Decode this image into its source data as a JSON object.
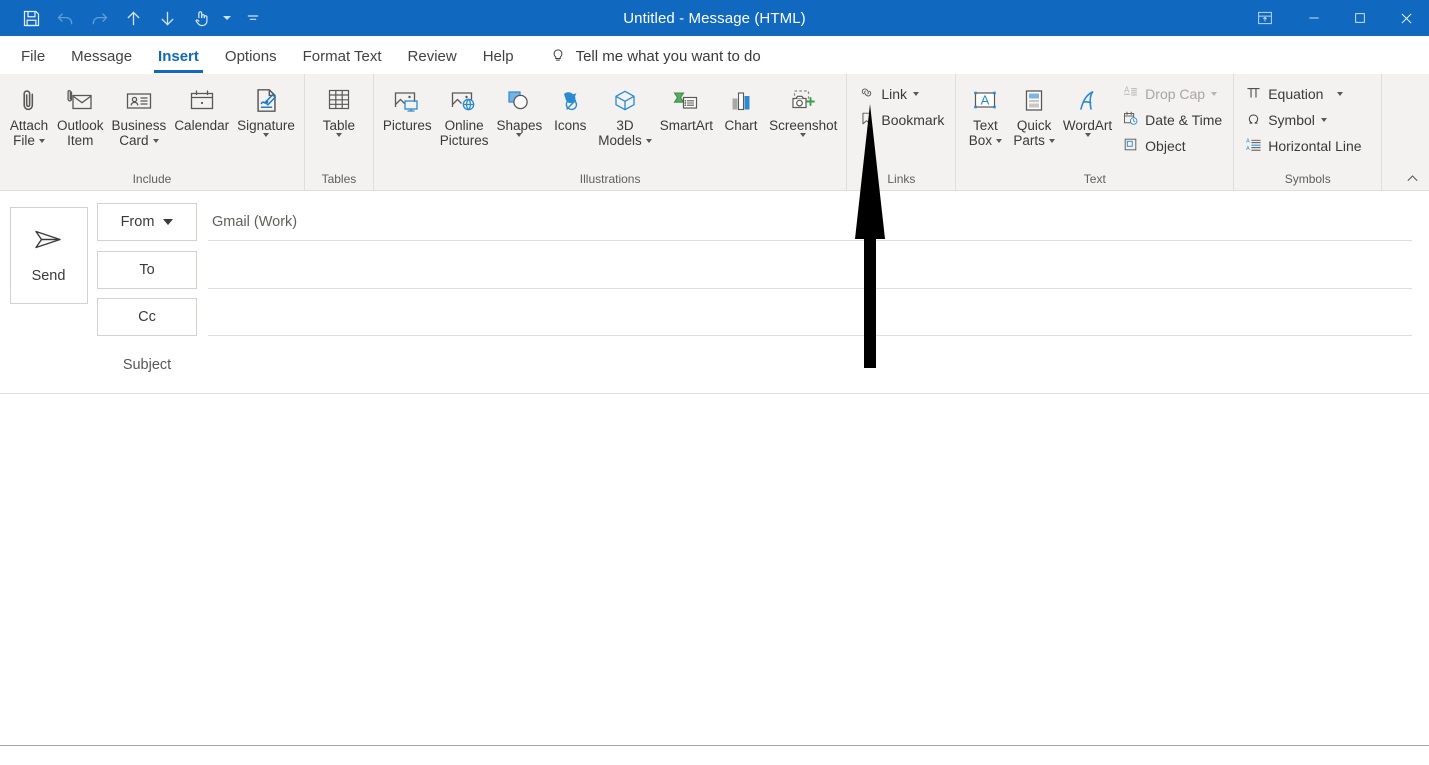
{
  "window": {
    "title": "Untitled  -  Message (HTML)",
    "quick_access": [
      {
        "name": "save-icon",
        "label": "Save"
      },
      {
        "name": "undo-icon",
        "label": "Undo"
      },
      {
        "name": "redo-icon",
        "label": "Redo"
      },
      {
        "name": "previous-item-icon",
        "label": "Previous Item"
      },
      {
        "name": "next-item-icon",
        "label": "Next Item"
      },
      {
        "name": "touch-mode-icon",
        "label": "Touch/Mouse Mode"
      }
    ],
    "controls": [
      {
        "name": "ribbon-display-options-button",
        "label": "Ribbon Display Options"
      },
      {
        "name": "minimize-button",
        "label": "Minimize"
      },
      {
        "name": "maximize-button",
        "label": "Maximize"
      },
      {
        "name": "close-button",
        "label": "Close"
      }
    ]
  },
  "tabs": [
    {
      "label": "File",
      "active": false
    },
    {
      "label": "Message",
      "active": false
    },
    {
      "label": "Insert",
      "active": true
    },
    {
      "label": "Options",
      "active": false
    },
    {
      "label": "Format Text",
      "active": false
    },
    {
      "label": "Review",
      "active": false
    },
    {
      "label": "Help",
      "active": false
    }
  ],
  "tell_me": {
    "icon": "lightbulb-icon",
    "placeholder": "Tell me what you want to do"
  },
  "ribbon": {
    "groups": [
      {
        "label": "Include",
        "buttons": [
          {
            "label_line1": "Attach",
            "label_line2": "File",
            "caret": true,
            "icon": "paperclip-icon"
          },
          {
            "label_line1": "Outlook",
            "label_line2": "Item",
            "caret": false,
            "icon": "envelope-attach-icon"
          },
          {
            "label_line1": "Business",
            "label_line2": "Card",
            "caret": true,
            "icon": "business-card-icon"
          },
          {
            "label_line1": "Calendar",
            "label_line2": "",
            "caret": false,
            "icon": "calendar-icon"
          },
          {
            "label_line1": "Signature",
            "label_line2": "",
            "caret": true,
            "icon": "signature-icon"
          }
        ]
      },
      {
        "label": "Tables",
        "buttons": [
          {
            "label_line1": "Table",
            "label_line2": "",
            "caret": true,
            "icon": "table-icon"
          }
        ]
      },
      {
        "label": "Illustrations",
        "buttons": [
          {
            "label_line1": "Pictures",
            "label_line2": "",
            "caret": false,
            "icon": "pictures-icon"
          },
          {
            "label_line1": "Online",
            "label_line2": "Pictures",
            "caret": false,
            "icon": "online-pictures-icon"
          },
          {
            "label_line1": "Shapes",
            "label_line2": "",
            "caret": true,
            "icon": "shapes-icon"
          },
          {
            "label_line1": "Icons",
            "label_line2": "",
            "caret": false,
            "icon": "icons-icon"
          },
          {
            "label_line1": "3D",
            "label_line2": "Models",
            "caret": true,
            "icon": "3d-models-icon"
          },
          {
            "label_line1": "SmartArt",
            "label_line2": "",
            "caret": false,
            "icon": "smartart-icon"
          },
          {
            "label_line1": "Chart",
            "label_line2": "",
            "caret": false,
            "icon": "chart-icon"
          },
          {
            "label_line1": "Screenshot",
            "label_line2": "",
            "caret": true,
            "icon": "screenshot-icon"
          }
        ]
      },
      {
        "label": "Links",
        "small_buttons": [
          {
            "label": "Link",
            "caret": true,
            "icon": "link-icon",
            "disabled": false
          },
          {
            "label": "Bookmark",
            "caret": false,
            "icon": "bookmark-icon",
            "disabled": false
          }
        ]
      },
      {
        "label": "Text",
        "buttons": [
          {
            "label_line1": "Text",
            "label_line2": "Box",
            "caret": true,
            "icon": "text-box-icon"
          },
          {
            "label_line1": "Quick",
            "label_line2": "Parts",
            "caret": true,
            "icon": "quick-parts-icon"
          },
          {
            "label_line1": "WordArt",
            "label_line2": "",
            "caret": true,
            "icon": "wordart-icon"
          }
        ],
        "small_buttons": [
          {
            "label": "Drop Cap",
            "caret": true,
            "icon": "drop-cap-icon",
            "disabled": true
          },
          {
            "label": "Date & Time",
            "caret": false,
            "icon": "date-time-icon",
            "disabled": false
          },
          {
            "label": "Object",
            "caret": false,
            "icon": "object-icon",
            "disabled": false
          }
        ]
      },
      {
        "label": "Symbols",
        "small_buttons": [
          {
            "label": "Equation",
            "caret": true,
            "icon": "equation-icon",
            "disabled": false
          },
          {
            "label": "Symbol",
            "caret": true,
            "icon": "symbol-icon",
            "disabled": false
          },
          {
            "label": "Horizontal Line",
            "caret": false,
            "icon": "horizontal-line-icon",
            "disabled": false
          }
        ]
      }
    ],
    "collapse": {
      "name": "collapse-ribbon-button",
      "label": "Collapse the Ribbon"
    }
  },
  "compose": {
    "send_label": "Send",
    "from_label": "From",
    "from_value": "Gmail (Work)",
    "to_label": "To",
    "to_value": "",
    "cc_label": "Cc",
    "cc_value": "",
    "subject_label": "Subject",
    "subject_value": "",
    "body_value": ""
  },
  "annotation": {
    "type": "arrow",
    "points_to": "Bookmark",
    "color": "#000000"
  },
  "colors": {
    "titlebar": "#1169bf",
    "ribbon_bg": "#f3f2f1",
    "accent": "#1169bf",
    "text": "#3b3a39"
  }
}
